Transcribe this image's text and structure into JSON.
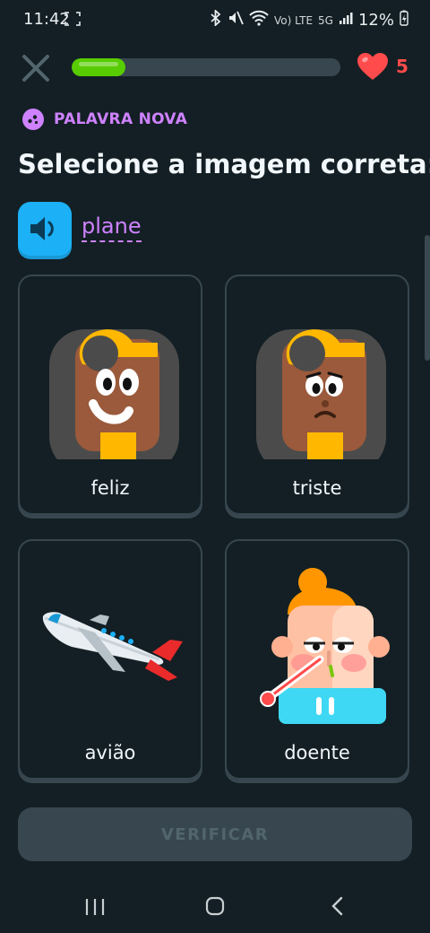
{
  "status_bar": {
    "time": "11:42",
    "network": "Vo) LTE",
    "network_5g": "5G",
    "battery": "12%"
  },
  "header": {
    "progress_fraction": 0.2,
    "hearts_count": "5"
  },
  "lesson": {
    "badge_label": "PALAVRA NOVA",
    "title": "Selecione a imagem correta:",
    "word": "plane"
  },
  "choices": [
    {
      "label": "feliz",
      "icon": "happy-woman-icon"
    },
    {
      "label": "triste",
      "icon": "sad-woman-icon"
    },
    {
      "label": "avião",
      "icon": "airplane-icon"
    },
    {
      "label": "doente",
      "icon": "sick-man-icon"
    }
  ],
  "footer": {
    "verify_label": "VERIFICAR"
  },
  "colors": {
    "background": "#131f24",
    "accent_purple": "#ce82ff",
    "progress_green": "#58cc02",
    "heart_red": "#ff4b4b",
    "audio_blue": "#1cb0f6",
    "card_border": "#37464f"
  }
}
